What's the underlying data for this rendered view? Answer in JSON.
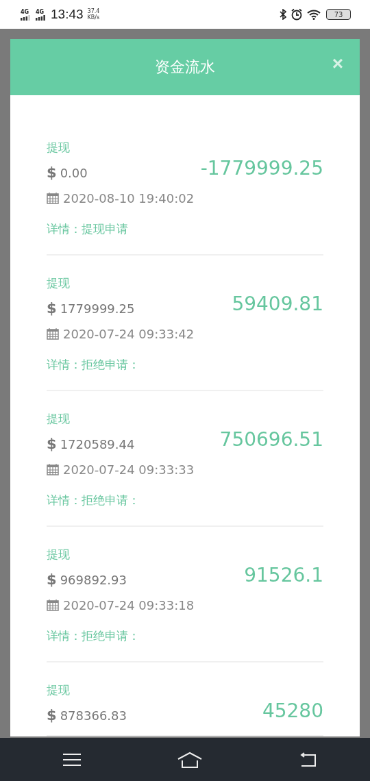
{
  "status_bar": {
    "network_1": "4G",
    "network_2": "4G",
    "time": "13:43",
    "speed_value": "37.4",
    "speed_unit": "KB/s",
    "battery": "73"
  },
  "dialog": {
    "title": "资金流水",
    "close": "×"
  },
  "entries": [
    {
      "type": "提现",
      "balance": "0.00",
      "currency": "$",
      "amount": "-1779999.25",
      "time": "2020-08-10 19:40:02",
      "detail": "详情：提现申请"
    },
    {
      "type": "提现",
      "balance": "1779999.25",
      "currency": "$",
      "amount": "59409.81",
      "time": "2020-07-24 09:33:42",
      "detail": "详情：拒绝申请："
    },
    {
      "type": "提现",
      "balance": "1720589.44",
      "currency": "$",
      "amount": "750696.51",
      "time": "2020-07-24 09:33:33",
      "detail": "详情：拒绝申请："
    },
    {
      "type": "提现",
      "balance": "969892.93",
      "currency": "$",
      "amount": "91526.1",
      "time": "2020-07-24 09:33:18",
      "detail": "详情：拒绝申请："
    },
    {
      "type": "提现",
      "balance": "878366.83",
      "currency": "$",
      "amount": "45280"
    }
  ]
}
